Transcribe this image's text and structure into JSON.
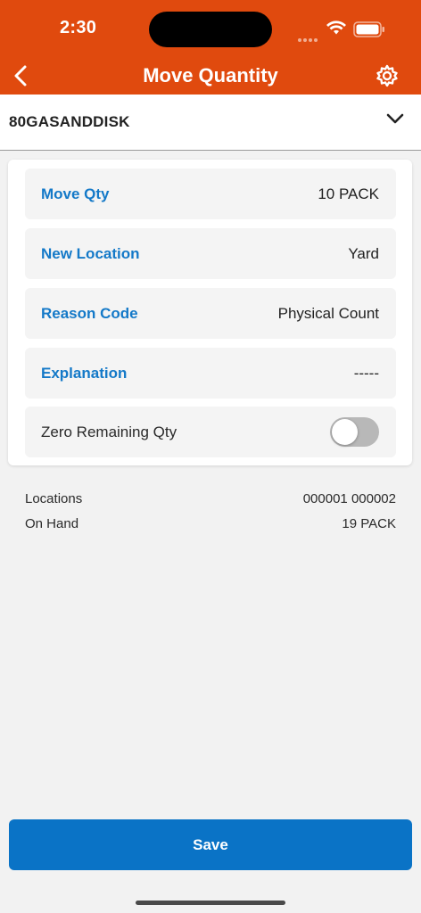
{
  "status_bar": {
    "time": "2:30"
  },
  "nav": {
    "title": "Move Quantity"
  },
  "selector": {
    "value": "80GASANDDISK"
  },
  "form": {
    "move_qty": {
      "label": "Move Qty",
      "value": "10 PACK"
    },
    "new_location": {
      "label": "New Location",
      "value": "Yard"
    },
    "reason_code": {
      "label": "Reason Code",
      "value": "Physical Count"
    },
    "explanation": {
      "label": "Explanation",
      "value": "-----"
    },
    "zero_remaining": {
      "label": "Zero Remaining Qty",
      "on": false
    }
  },
  "info": {
    "locations": {
      "label": "Locations",
      "value": "000001 000002"
    },
    "on_hand": {
      "label": "On Hand",
      "value": "19 PACK"
    }
  },
  "actions": {
    "save_label": "Save"
  },
  "colors": {
    "header": "#e04a0e",
    "accent_text": "#1479c8",
    "primary_button": "#0a73c6"
  }
}
